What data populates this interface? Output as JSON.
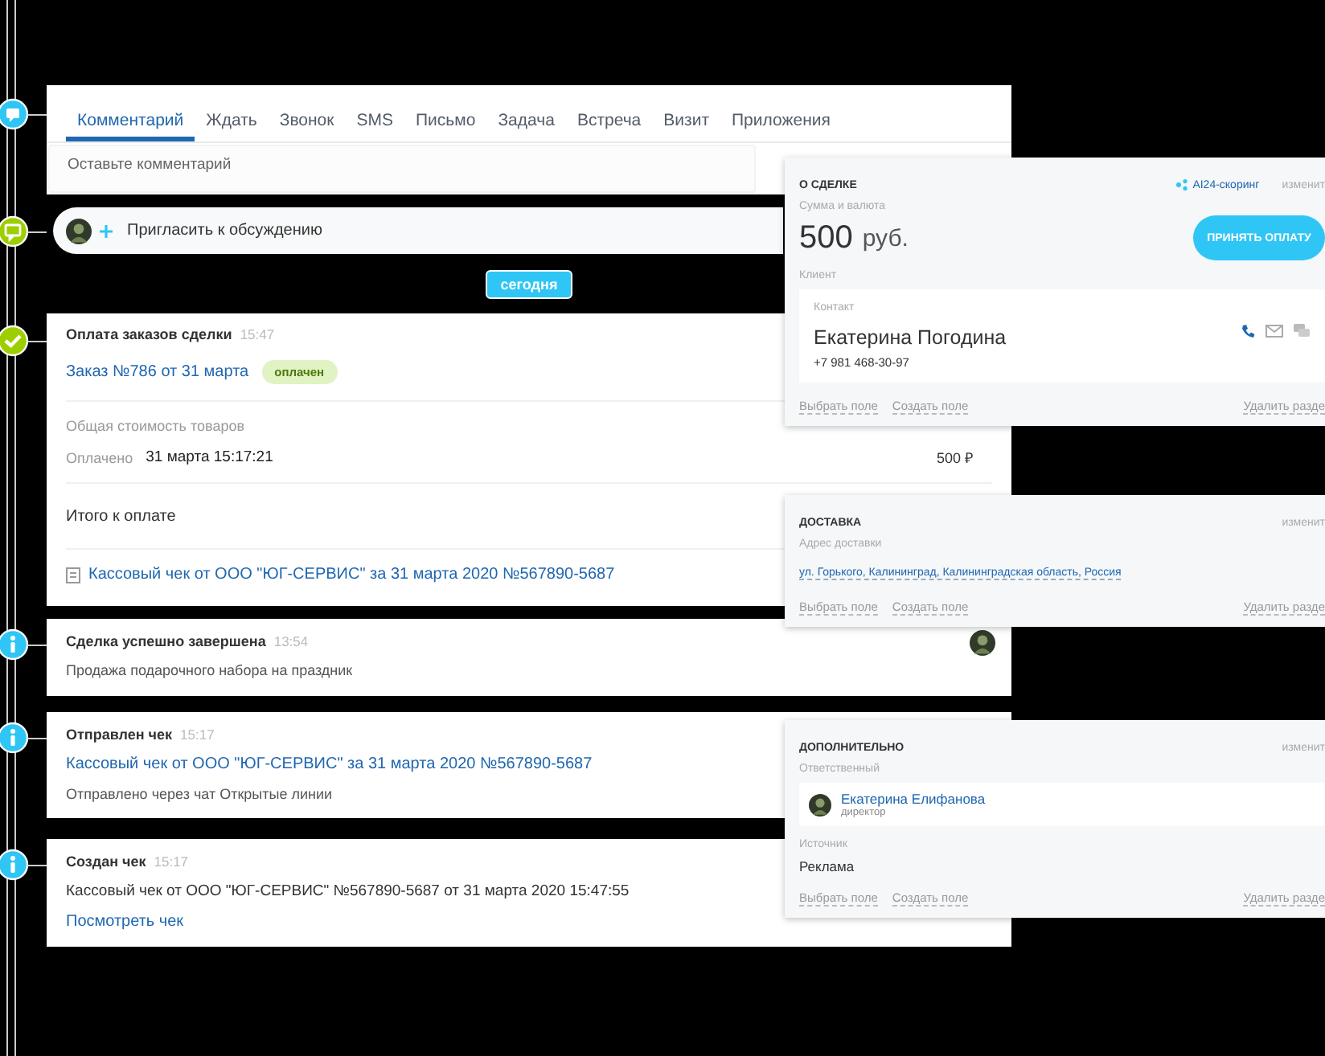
{
  "timeline": [
    {
      "kind": "composer",
      "tabs": [
        {
          "label": "Комментарий",
          "selected": true
        },
        {
          "label": "Ждать",
          "selected": false
        },
        {
          "label": "Звонок",
          "selected": false
        },
        {
          "label": "SMS",
          "selected": false
        },
        {
          "label": "Письмо",
          "selected": false
        },
        {
          "label": "Задача",
          "selected": false
        },
        {
          "label": "Встреча",
          "selected": false
        },
        {
          "label": "Визит",
          "selected": false
        },
        {
          "label": "Приложения",
          "selected": false
        }
      ],
      "placeholder": "Оставьте комментарий"
    },
    {
      "kind": "invite",
      "label": "Пригласить к обсуждению"
    },
    {
      "kind": "date",
      "label": "сегодня"
    },
    {
      "kind": "payment",
      "title": "Оплата заказов сделки",
      "time": "15:47",
      "order_link": "Заказ №786 от 31 марта",
      "order_status": "оплачен",
      "total_label": "Общая стоимость товаров",
      "paid_label": "Оплачено",
      "paid_value": "31 марта 15:17:21",
      "amount": "500 ₽",
      "due_label": "Итого к оплате",
      "receipt_link": "Кассовый чек от ООО \"ЮГ-СЕРВИС\" за 31 марта 2020 №567890-5687"
    },
    {
      "kind": "event",
      "title": "Сделка успешно завершена",
      "time": "13:54",
      "avatar": true,
      "lines": [
        {
          "kind": "text",
          "text": "Продажа подарочного набора на праздник"
        }
      ]
    },
    {
      "kind": "event",
      "title": "Отправлен чек",
      "time": "15:17",
      "lines": [
        {
          "kind": "link",
          "text": "Кассовый чек от ООО \"ЮГ-СЕРВИС\" за 31 марта 2020 №567890-5687"
        },
        {
          "kind": "text",
          "text": "Отправлено через чат Открытые линии"
        }
      ]
    },
    {
      "kind": "event",
      "title": "Создан чек",
      "time": "15:17",
      "lines": [
        {
          "kind": "dark",
          "text": "Кассовый чек от ООО \"ЮГ-СЕРВИС\" №567890-5687 от 31 марта 2020 15:47:55"
        },
        {
          "kind": "link",
          "text": "Посмотреть чек"
        }
      ]
    }
  ],
  "panels": [
    {
      "kind": "deal",
      "title": "О СДЕЛКЕ",
      "scoring": "AI24-скоринг",
      "edit": "изменит",
      "amount_label": "Сумма и валюта",
      "amount": "500",
      "currency": "руб.",
      "pay_button": "ПРИНЯТЬ ОПЛАТУ",
      "client_label": "Клиент",
      "contact_label": "Контакт",
      "contact_name": "Екатерина Погодина",
      "phone": "+7 981 468-30-97",
      "footer": [
        "Выбрать поле",
        "Создать поле"
      ],
      "delete": "Удалить разде"
    },
    {
      "kind": "delivery",
      "title": "ДОСТАВКА",
      "edit": "изменит",
      "address_label": "Адрес доставки",
      "address": "ул. Горького, Калининград, Калининградская область, Россия",
      "footer": [
        "Выбрать поле",
        "Создать поле"
      ],
      "delete": "Удалить разде"
    },
    {
      "kind": "extra",
      "title": "ДОПОЛНИТЕЛЬНО",
      "edit": "изменит",
      "responsible_label": "Ответственный",
      "person_name": "Екатерина Елифанова",
      "person_role": "директор",
      "source_label": "Источник",
      "source": "Реклама",
      "footer": [
        "Выбрать поле",
        "Создать поле"
      ],
      "delete": "Удалить разде"
    }
  ]
}
